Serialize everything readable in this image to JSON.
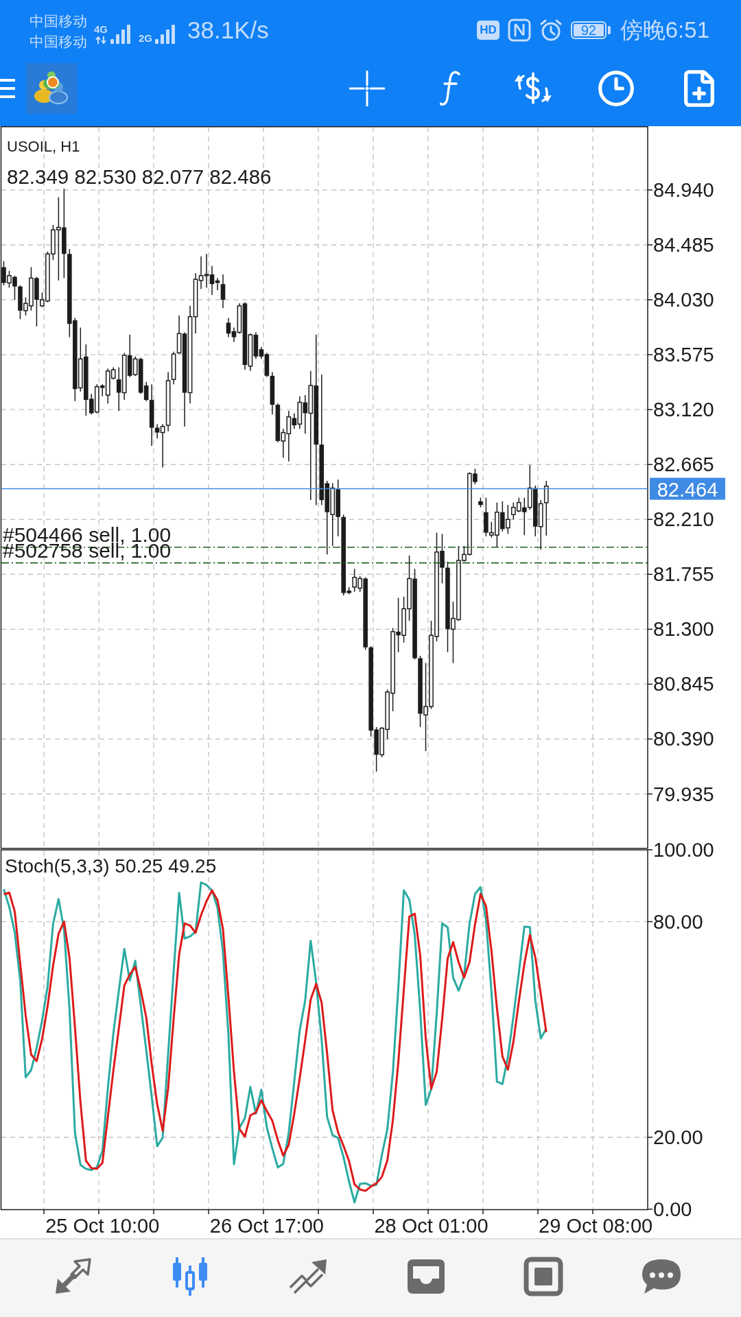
{
  "status_bar": {
    "carriers": [
      "中国移动",
      "中国移动"
    ],
    "networks": [
      {
        "label": "4G",
        "activity": true
      },
      {
        "label": "2G",
        "activity": false
      }
    ],
    "speed": "38.1K/s",
    "hd": "HD",
    "battery": "92",
    "time": "傍晚6:51"
  },
  "chart": {
    "chart_data": {
      "type": "candlestick",
      "title": "USOIL, H1",
      "grid": true,
      "categories": [
        null,
        null,
        null,
        null,
        null,
        null,
        null,
        null,
        null,
        null,
        null,
        null,
        null,
        null,
        null,
        null,
        null,
        null,
        null,
        null,
        null,
        null,
        null,
        null,
        null,
        null,
        null,
        null,
        null,
        null,
        null,
        null,
        null,
        null,
        null,
        null,
        null,
        null,
        null,
        null,
        null,
        null,
        null,
        null,
        null,
        null,
        null,
        null,
        null,
        null,
        null,
        null,
        null,
        null,
        null,
        null,
        null,
        null,
        null,
        null,
        null,
        null,
        null,
        null,
        null,
        null,
        null,
        null,
        null,
        null,
        null,
        null,
        null,
        null,
        null,
        null,
        null,
        null,
        null,
        null,
        null,
        null,
        null,
        null,
        null,
        null,
        null,
        null,
        null,
        null,
        null,
        null,
        null,
        null,
        null,
        null,
        null,
        null,
        null,
        null,
        null,
        null,
        null,
        null,
        null,
        null,
        null,
        null,
        null,
        null,
        null,
        null,
        null,
        null,
        null,
        null,
        null,
        null
      ],
      "ylim": [
        79.486,
        85.464
      ],
      "yticks": [
        {
          "value": 84.94,
          "label": "84.940"
        },
        {
          "value": 84.485,
          "label": "84.485"
        },
        {
          "value": 84.03,
          "label": "84.030"
        },
        {
          "value": 83.575,
          "label": "83.575"
        },
        {
          "value": 83.12,
          "label": "83.120"
        },
        {
          "value": 82.665,
          "label": "82.665"
        },
        {
          "value": 82.21,
          "label": "82.210"
        },
        {
          "value": 81.755,
          "label": "81.755"
        },
        {
          "value": 81.3,
          "label": "81.300"
        },
        {
          "value": 80.845,
          "label": "80.845"
        },
        {
          "value": 80.39,
          "label": "80.390"
        },
        {
          "value": 79.935,
          "label": "79.935"
        }
      ],
      "ref_lines": [
        {
          "axis": "y",
          "value": 82.464,
          "label": "82.464",
          "color": "#3f8ae4"
        },
        {
          "axis": "y",
          "value": 81.98,
          "label": "#504466 sell, 1.00",
          "color": "#1f5f1f"
        },
        {
          "axis": "y",
          "value": 81.85,
          "label": "#502758 sell, 1.00",
          "color": "#1f5f1f"
        }
      ],
      "ohlc": [
        [
          84.3,
          84.35,
          84.15,
          84.17
        ],
        [
          84.17,
          84.27,
          84.13,
          84.23
        ],
        [
          84.22,
          84.23,
          84.03,
          84.14
        ],
        [
          84.14,
          84.15,
          83.87,
          83.94
        ],
        [
          83.94,
          84.05,
          83.9,
          84.0
        ],
        [
          83.98,
          84.3,
          83.94,
          84.21
        ],
        [
          84.21,
          84.22,
          83.81,
          84.03
        ],
        [
          83.98,
          84.09,
          83.97,
          84.03
        ],
        [
          84.02,
          84.43,
          84.01,
          84.41
        ],
        [
          84.41,
          84.65,
          84.36,
          84.61
        ],
        [
          84.61,
          84.88,
          84.19,
          84.63
        ],
        [
          84.63,
          84.95,
          84.21,
          84.41
        ],
        [
          84.41,
          84.45,
          83.72,
          83.83
        ],
        [
          83.86,
          83.88,
          83.19,
          83.29
        ],
        [
          83.3,
          83.8,
          83.27,
          83.54
        ],
        [
          83.56,
          83.66,
          83.07,
          83.2
        ],
        [
          83.21,
          83.25,
          83.08,
          83.09
        ],
        [
          83.1,
          83.33,
          83.09,
          83.31
        ],
        [
          83.32,
          83.33,
          83.23,
          83.3
        ],
        [
          83.24,
          83.46,
          83.17,
          83.44
        ],
        [
          83.38,
          83.47,
          83.37,
          83.45
        ],
        [
          83.37,
          83.47,
          83.11,
          83.26
        ],
        [
          83.26,
          83.59,
          83.2,
          83.57
        ],
        [
          83.57,
          83.74,
          83.39,
          83.4
        ],
        [
          83.41,
          83.56,
          83.4,
          83.54
        ],
        [
          83.54,
          83.55,
          83.25,
          83.26
        ],
        [
          83.32,
          83.35,
          83.19,
          83.2
        ],
        [
          83.2,
          83.33,
          82.82,
          82.97
        ],
        [
          82.97,
          83.0,
          82.88,
          82.93
        ],
        [
          82.93,
          83.0,
          82.64,
          82.98
        ],
        [
          82.99,
          83.43,
          82.94,
          83.36
        ],
        [
          83.37,
          83.6,
          83.33,
          83.58
        ],
        [
          83.59,
          83.9,
          83.58,
          83.75
        ],
        [
          83.75,
          83.76,
          82.98,
          83.26
        ],
        [
          83.26,
          83.98,
          83.17,
          83.89
        ],
        [
          83.89,
          84.25,
          83.75,
          84.2
        ],
        [
          84.19,
          84.39,
          84.12,
          84.23
        ],
        [
          84.23,
          84.41,
          84.13,
          84.24
        ],
        [
          84.24,
          84.31,
          84.07,
          84.16
        ],
        [
          84.19,
          84.21,
          84.11,
          84.17
        ],
        [
          84.16,
          84.24,
          83.96,
          84.03
        ],
        [
          83.84,
          83.88,
          83.72,
          83.75
        ],
        [
          83.77,
          83.8,
          83.68,
          83.72
        ],
        [
          83.76,
          84.0,
          83.75,
          83.98
        ],
        [
          84.0,
          84.01,
          83.45,
          83.49
        ],
        [
          83.48,
          83.75,
          83.44,
          83.74
        ],
        [
          83.74,
          83.76,
          83.54,
          83.56
        ],
        [
          83.62,
          83.64,
          83.54,
          83.56
        ],
        [
          83.58,
          83.59,
          83.39,
          83.4
        ],
        [
          83.4,
          83.43,
          83.08,
          83.16
        ],
        [
          83.16,
          83.17,
          82.85,
          82.86
        ],
        [
          82.86,
          82.96,
          82.72,
          82.93
        ],
        [
          82.92,
          83.11,
          82.69,
          83.06
        ],
        [
          83.05,
          83.09,
          82.96,
          82.99
        ],
        [
          83.0,
          83.23,
          82.96,
          83.18
        ],
        [
          83.18,
          83.24,
          82.92,
          83.09
        ],
        [
          83.09,
          83.44,
          82.37,
          83.32
        ],
        [
          83.32,
          83.74,
          82.33,
          82.83
        ],
        [
          82.83,
          83.41,
          82.33,
          82.37
        ],
        [
          82.51,
          82.53,
          81.92,
          82.27
        ],
        [
          82.25,
          82.51,
          81.99,
          82.47
        ],
        [
          82.46,
          82.54,
          82.07,
          82.23
        ],
        [
          82.23,
          82.25,
          81.58,
          81.6
        ],
        [
          81.62,
          81.65,
          81.59,
          81.6
        ],
        [
          81.65,
          81.8,
          81.61,
          81.73
        ],
        [
          81.64,
          81.74,
          81.61,
          81.72
        ],
        [
          81.72,
          81.73,
          81.13,
          81.15
        ],
        [
          81.15,
          81.16,
          80.41,
          80.46
        ],
        [
          80.47,
          80.49,
          80.12,
          80.26
        ],
        [
          80.26,
          80.49,
          80.24,
          80.48
        ],
        [
          80.47,
          80.8,
          80.39,
          80.78
        ],
        [
          80.77,
          81.31,
          80.62,
          81.28
        ],
        [
          81.28,
          81.56,
          81.11,
          81.25
        ],
        [
          81.25,
          81.57,
          81.19,
          81.47
        ],
        [
          81.47,
          81.91,
          81.37,
          81.72
        ],
        [
          81.72,
          81.8,
          81.05,
          81.06
        ],
        [
          81.06,
          81.08,
          80.49,
          80.6
        ],
        [
          80.59,
          81.02,
          80.29,
          80.66
        ],
        [
          80.66,
          81.37,
          80.64,
          81.25
        ],
        [
          81.24,
          82.1,
          81.2,
          81.94
        ],
        [
          81.95,
          82.09,
          81.68,
          81.81
        ],
        [
          81.81,
          81.86,
          81.11,
          81.3
        ],
        [
          81.3,
          81.53,
          81.02,
          81.39
        ],
        [
          81.38,
          81.99,
          81.37,
          81.87
        ],
        [
          81.87,
          81.99,
          81.86,
          81.92
        ],
        [
          81.92,
          82.6,
          81.91,
          82.59
        ],
        [
          82.59,
          82.63,
          82.5,
          82.52
        ],
        [
          82.36,
          82.39,
          82.31,
          82.33
        ],
        [
          82.27,
          82.39,
          82.07,
          82.1
        ],
        [
          82.08,
          82.19,
          82.06,
          82.1
        ],
        [
          82.08,
          82.35,
          81.98,
          82.27
        ],
        [
          82.27,
          82.36,
          82.11,
          82.13
        ],
        [
          82.14,
          82.33,
          82.09,
          82.21
        ],
        [
          82.25,
          82.35,
          82.21,
          82.31
        ],
        [
          82.28,
          82.39,
          82.27,
          82.35
        ],
        [
          82.31,
          82.39,
          82.08,
          82.27
        ],
        [
          82.31,
          82.66,
          82.29,
          82.47
        ],
        [
          82.47,
          82.49,
          82.07,
          82.15
        ],
        [
          82.15,
          82.37,
          81.96,
          82.34
        ],
        [
          82.349,
          82.53,
          82.077,
          82.486
        ],
        null,
        null,
        null,
        null,
        null,
        null,
        null,
        null,
        null,
        null,
        null,
        null,
        null,
        null,
        null,
        null,
        null,
        null
      ]
    },
    "ohlc_readout": "82.349 82.530 82.077 82.486"
  },
  "indicator": {
    "chart_data": {
      "type": "line",
      "title": "Stoch(5,3,3) 50.25 49.25",
      "grid": true,
      "categories": [
        null,
        null,
        null,
        null,
        null,
        null,
        null,
        null,
        null,
        null,
        null,
        null,
        null,
        null,
        null,
        null,
        null,
        null,
        "25 Oct 10:00",
        null,
        null,
        null,
        null,
        null,
        null,
        null,
        null,
        null,
        null,
        null,
        null,
        null,
        null,
        null,
        null,
        null,
        null,
        null,
        null,
        null,
        null,
        null,
        null,
        null,
        null,
        null,
        null,
        null,
        "26 Oct 17:00",
        null,
        null,
        null,
        null,
        null,
        null,
        null,
        null,
        null,
        null,
        null,
        null,
        null,
        null,
        null,
        null,
        null,
        null,
        null,
        null,
        null,
        null,
        null,
        null,
        null,
        null,
        null,
        null,
        null,
        "28 Oct 01:00",
        null,
        null,
        null,
        null,
        null,
        null,
        null,
        null,
        null,
        null,
        null,
        null,
        null,
        null,
        null,
        null,
        null,
        null,
        null,
        null,
        null,
        null,
        null,
        null,
        null,
        null,
        null,
        null,
        null,
        "29 Oct 08:00",
        null,
        null,
        null,
        null,
        null,
        null,
        null,
        null,
        null
      ],
      "ylim": [
        0,
        100
      ],
      "yticks": [
        {
          "value": 100,
          "label": "100.00"
        },
        {
          "value": 80,
          "label": "80.00"
        },
        {
          "value": 20,
          "label": "20.00"
        },
        {
          "value": 0,
          "label": "0.00"
        }
      ],
      "series": [
        {
          "color": "#2aaba2",
          "values": [
            89,
            84.1,
            77,
            63.6,
            36.7,
            38.7,
            44.9,
            52.5,
            62.1,
            79.4,
            86.3,
            77.7,
            55.7,
            21.2,
            12.3,
            11.2,
            10.9,
            11.7,
            16.3,
            33.8,
            48.9,
            60.8,
            72.4,
            63.6,
            69.1,
            56.6,
            44.2,
            31.2,
            17.5,
            19.9,
            43.3,
            66.1,
            88,
            75.3,
            75.9,
            77.2,
            90.9,
            90.2,
            88.7,
            83.9,
            71.5,
            48.2,
            12.5,
            22.6,
            25.3,
            34,
            26.6,
            33.2,
            22.8,
            16.9,
            11.6,
            12.6,
            21.2,
            35.4,
            49.7,
            58.1,
            74.7,
            63.1,
            47.1,
            25.7,
            20.6,
            19.8,
            14.5,
            7.7,
            1.9,
            7,
            7.2,
            6.5,
            6.8,
            15.1,
            22.3,
            38.1,
            61.7,
            88.7,
            86.1,
            76.3,
            55.1,
            29,
            33.4,
            54.4,
            79.5,
            78.4,
            64.4,
            60.8,
            64.9,
            79.5,
            87.7,
            89.6,
            80.3,
            60.3,
            35.5,
            34.8,
            42.4,
            53.6,
            65.9,
            78.6,
            78.5,
            57.9,
            47.5,
            50.25,
            null,
            null,
            null,
            null,
            null,
            null,
            null,
            null,
            null,
            null,
            null,
            null,
            null,
            null,
            null,
            null,
            null,
            null
          ]
        },
        {
          "color": "#dd1a1a",
          "values": [
            87.6,
            88.1,
            82.8,
            68.3,
            53.9,
            43,
            41.2,
            47.4,
            56.5,
            67.8,
            76.7,
            80,
            69.9,
            50.5,
            29.6,
            13.5,
            11.4,
            11.2,
            12.9,
            25.8,
            38.5,
            50.3,
            62.2,
            65.3,
            67.4,
            60.9,
            53.3,
            40.2,
            29.2,
            21.8,
            33.7,
            53,
            70.9,
            79.5,
            78.9,
            76.9,
            81.8,
            85.7,
            88.7,
            86,
            77.9,
            58.8,
            38.3,
            22.3,
            20.2,
            26.1,
            26.9,
            30.3,
            27.3,
            24.6,
            19.2,
            14.9,
            17.9,
            26.5,
            36.4,
            47,
            58.3,
            62.7,
            57.4,
            43.5,
            27.5,
            21.4,
            17.6,
            13.4,
            6.9,
            5.5,
            5.1,
            6.3,
            7.2,
            9,
            13.6,
            24.7,
            41,
            61.2,
            81.4,
            82.2,
            70.5,
            47.6,
            33.5,
            38.2,
            53,
            69.8,
            74.3,
            68.7,
            64.4,
            68.8,
            79.3,
            87.7,
            84.3,
            71.7,
            55.9,
            42.5,
            38.8,
            46.6,
            57.9,
            68.3,
            76.3,
            70,
            59.8,
            49.25,
            null,
            null,
            null,
            null,
            null,
            null,
            null,
            null,
            null,
            null,
            null,
            null,
            null,
            null,
            null,
            null,
            null,
            null
          ]
        }
      ]
    }
  },
  "bottom_nav": [
    {
      "selected": false
    },
    {
      "selected": true
    },
    {
      "selected": false
    },
    {
      "selected": false
    },
    {
      "selected": false
    },
    {
      "selected": false
    }
  ]
}
